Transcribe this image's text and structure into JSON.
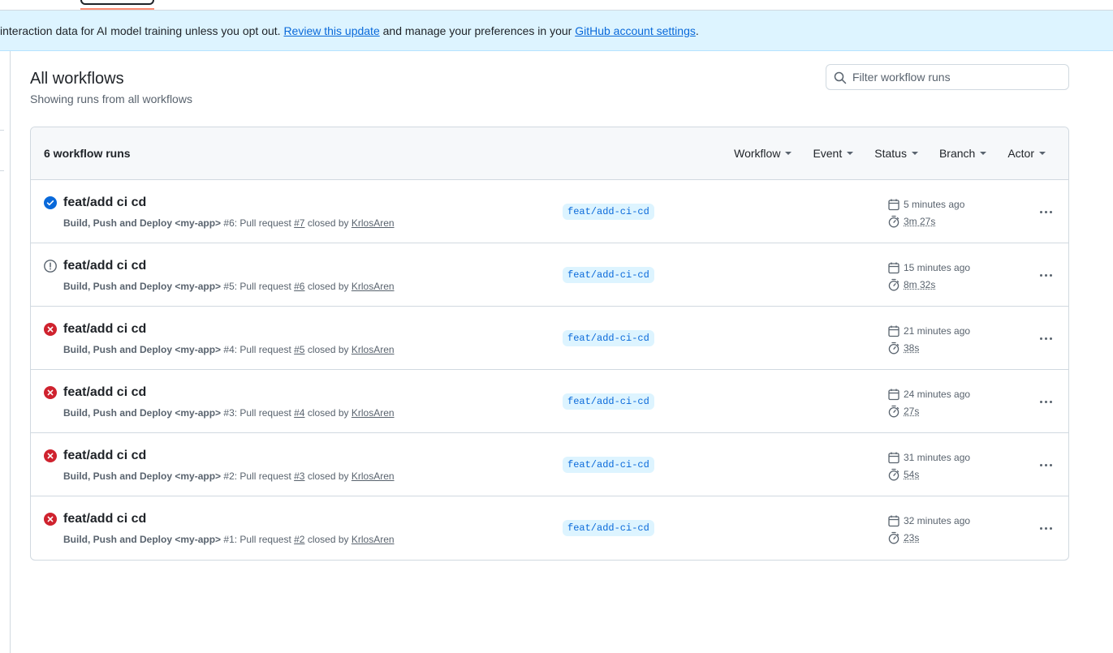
{
  "banner": {
    "text_before": "interaction data for AI model training unless you opt out. ",
    "link1": "Review this update",
    "text_middle": " and manage your preferences in your ",
    "link2": "GitHub account settings",
    "text_after": "."
  },
  "header": {
    "title": "All workflows",
    "subtitle": "Showing runs from all workflows",
    "filter_placeholder": "Filter workflow runs"
  },
  "runs_box": {
    "count_label": "6 workflow runs",
    "filters": [
      "Workflow",
      "Event",
      "Status",
      "Branch",
      "Actor"
    ]
  },
  "runs": [
    {
      "status": "success",
      "title": "feat/add ci cd",
      "workflow": "Build, Push and Deploy <my-app>",
      "run": "#6",
      "event_text": ": Pull request ",
      "pr": "#7",
      "closed_by": " closed by ",
      "actor": "KrlosAren",
      "branch": "feat/add-ci-cd",
      "when": "5 minutes ago",
      "duration": "3m 27s"
    },
    {
      "status": "warning",
      "title": "feat/add ci cd",
      "workflow": "Build, Push and Deploy <my-app>",
      "run": "#5",
      "event_text": ": Pull request ",
      "pr": "#6",
      "closed_by": " closed by ",
      "actor": "KrlosAren",
      "branch": "feat/add-ci-cd",
      "when": "15 minutes ago",
      "duration": "8m 32s"
    },
    {
      "status": "failure",
      "title": "feat/add ci cd",
      "workflow": "Build, Push and Deploy <my-app>",
      "run": "#4",
      "event_text": ": Pull request ",
      "pr": "#5",
      "closed_by": " closed by ",
      "actor": "KrlosAren",
      "branch": "feat/add-ci-cd",
      "when": "21 minutes ago",
      "duration": "38s"
    },
    {
      "status": "failure",
      "title": "feat/add ci cd",
      "workflow": "Build, Push and Deploy <my-app>",
      "run": "#3",
      "event_text": ": Pull request ",
      "pr": "#4",
      "closed_by": " closed by ",
      "actor": "KrlosAren",
      "branch": "feat/add-ci-cd",
      "when": "24 minutes ago",
      "duration": "27s"
    },
    {
      "status": "failure",
      "title": "feat/add ci cd",
      "workflow": "Build, Push and Deploy <my-app>",
      "run": "#2",
      "event_text": ": Pull request ",
      "pr": "#3",
      "closed_by": " closed by ",
      "actor": "KrlosAren",
      "branch": "feat/add-ci-cd",
      "when": "31 minutes ago",
      "duration": "54s"
    },
    {
      "status": "failure",
      "title": "feat/add ci cd",
      "workflow": "Build, Push and Deploy <my-app>",
      "run": "#1",
      "event_text": ": Pull request ",
      "pr": "#2",
      "closed_by": " closed by ",
      "actor": "KrlosAren",
      "branch": "feat/add-ci-cd",
      "when": "32 minutes ago",
      "duration": "23s"
    }
  ],
  "colors": {
    "success": "#0969da",
    "failure": "#cf222e",
    "warning": "#59636e",
    "accent": "#0969da"
  }
}
